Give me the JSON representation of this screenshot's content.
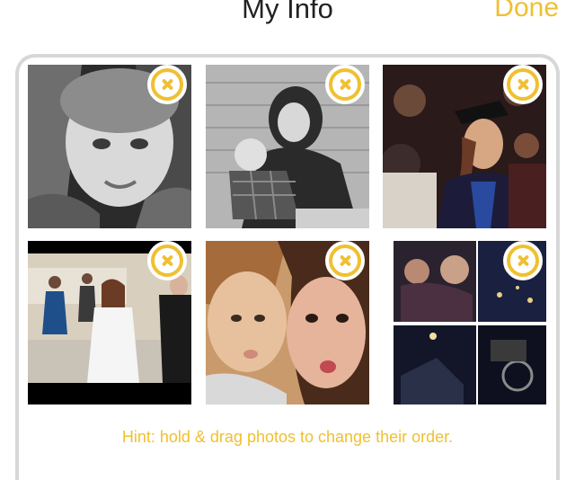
{
  "header": {
    "title": "My Info",
    "done_label": "Done"
  },
  "photos": {
    "hint": "Hint: hold & drag photos to change their order."
  },
  "colors": {
    "accent": "#f0c030",
    "panel_border": "#d7d7d7",
    "title_text": "#222222"
  },
  "icons": {
    "remove": "close-circle-icon"
  }
}
